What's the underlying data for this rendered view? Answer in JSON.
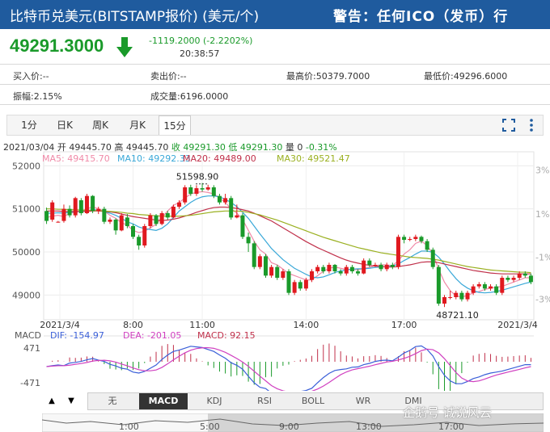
{
  "header": {
    "title": "比特币兑美元(BITSTAMP报价) (美元/个)",
    "warning": "警告：任何ICO（发币）行"
  },
  "quote": {
    "price": "49291.3000",
    "change": "-1119.2000 (-2.2202%)",
    "time": "20:38:57",
    "bid": "买入价:--",
    "ask": "卖出价:--",
    "high": "最高价:50379.7000",
    "low": "最低价:49296.6000",
    "amplitude": "振幅:2.15%",
    "volume": "成交量:6196.0000",
    "colors": {
      "down": "#1a9a2a",
      "up": "#e0191f"
    }
  },
  "tabs": [
    "1分",
    "日K",
    "周K",
    "月K",
    "15分"
  ],
  "active_tab": "15分",
  "ohlc": {
    "date": "2021/03/04",
    "open": "开 49445.70",
    "high": "高 49445.70",
    "close": "收 49291.30",
    "low": "低 49291.30",
    "vol": "量 0",
    "pct": "-0.31%"
  },
  "ma_legend": [
    {
      "label": "MA5: 49415.70",
      "color": "#f08aa8"
    },
    {
      "label": "MA10: 49292.33",
      "color": "#3aa8d8"
    },
    {
      "label": "MA20: 49489.00",
      "color": "#c0304a"
    },
    {
      "label": "MA30: 49521.47",
      "color": "#9ab020"
    }
  ],
  "macd_legend": [
    {
      "label": "MACD",
      "color": "#555555"
    },
    {
      "label": "DIF: -154.97",
      "color": "#3a5fd8"
    },
    {
      "label": "DEA: -201.05",
      "color": "#d040c0"
    },
    {
      "label": "MACD: 92.15",
      "color": "#c0304a"
    }
  ],
  "indicator_tabs": [
    "无",
    "MACD",
    "KDJ",
    "RSI",
    "BOLL",
    "WR",
    "DMI"
  ],
  "active_indicator": "MACD",
  "nav_buttons": [
    "▲",
    "▼"
  ],
  "navigator_labels": [
    "1:00",
    "5:00",
    "9:00",
    "13:00",
    "17:00"
  ],
  "watermark": "企鹅号 诚说风云",
  "chart_data": {
    "type": "candlestick",
    "y_ticks": [
      "52000",
      "51000",
      "50000",
      "49000"
    ],
    "ylim": [
      48650,
      52100
    ],
    "pct_ticks": [
      "3%",
      "1%",
      "-1%",
      "-3%"
    ],
    "x_ticks": [
      "2021/3/4",
      "8:00",
      "11:00",
      "14:00",
      "17:00",
      "2021/3/4"
    ],
    "annotations": {
      "max_label": "51598.90",
      "min_label": "48721.10"
    },
    "macd_ticks": [
      "471",
      "-471"
    ],
    "candles": [
      [
        50950,
        50720,
        51030,
        50650
      ],
      [
        50750,
        51150,
        51200,
        50700
      ],
      [
        50700,
        50700,
        50720,
        50680
      ],
      [
        50720,
        51000,
        51100,
        50680
      ],
      [
        51000,
        50850,
        51080,
        50800
      ],
      [
        50850,
        51250,
        51280,
        50800
      ],
      [
        51200,
        50900,
        51250,
        50850
      ],
      [
        50900,
        51300,
        51350,
        50880
      ],
      [
        51300,
        50950,
        51320,
        50900
      ],
      [
        50950,
        51000,
        51050,
        50880
      ],
      [
        51000,
        50700,
        51050,
        50650
      ],
      [
        50700,
        50750,
        50800,
        50650
      ],
      [
        50750,
        50500,
        50780,
        50400
      ],
      [
        50500,
        50850,
        50900,
        50480
      ],
      [
        50800,
        50600,
        50880,
        50550
      ],
      [
        50600,
        50350,
        50650,
        50300
      ],
      [
        50350,
        50150,
        50400,
        50050
      ],
      [
        50150,
        50600,
        50650,
        50100
      ],
      [
        50600,
        50850,
        50900,
        50550
      ],
      [
        50850,
        50650,
        50880,
        50600
      ],
      [
        50650,
        50900,
        50950,
        50620
      ],
      [
        50900,
        50800,
        50950,
        50750
      ],
      [
        50800,
        51050,
        51100,
        50780
      ],
      [
        51050,
        51150,
        51200,
        51000
      ],
      [
        51150,
        51500,
        51550,
        51100
      ],
      [
        51500,
        51350,
        51560,
        51300
      ],
      [
        51350,
        51480,
        51550,
        51300
      ],
      [
        51480,
        51450,
        51600,
        51400
      ],
      [
        51450,
        51500,
        51560,
        51420
      ],
      [
        51500,
        51300,
        51550,
        51250
      ],
      [
        51300,
        51150,
        51350,
        51100
      ],
      [
        51150,
        51250,
        51350,
        51100
      ],
      [
        51250,
        50800,
        51300,
        50750
      ],
      [
        50800,
        50850,
        51100,
        50780
      ],
      [
        50850,
        50350,
        50900,
        50300
      ],
      [
        50350,
        50200,
        50450,
        50000
      ],
      [
        50200,
        49650,
        50250,
        49600
      ],
      [
        49650,
        49900,
        49950,
        49600
      ],
      [
        49900,
        49450,
        49950,
        49400
      ],
      [
        49450,
        49650,
        49700,
        49400
      ],
      [
        49650,
        49400,
        49700,
        49350
      ],
      [
        49400,
        49550,
        49600,
        49350
      ],
      [
        49550,
        49050,
        49600,
        49000
      ],
      [
        49050,
        49300,
        49350,
        49000
      ],
      [
        49300,
        49150,
        49350,
        49100
      ],
      [
        49150,
        49350,
        49400,
        49100
      ],
      [
        49350,
        49550,
        49600,
        49300
      ],
      [
        49550,
        49650,
        49700,
        49500
      ],
      [
        49650,
        49550,
        49700,
        49500
      ],
      [
        49550,
        49700,
        49750,
        49500
      ],
      [
        49700,
        49550,
        49720,
        49500
      ],
      [
        49550,
        49500,
        49600,
        49450
      ],
      [
        49500,
        49650,
        49700,
        49450
      ],
      [
        49650,
        49550,
        49700,
        49500
      ],
      [
        49550,
        49500,
        49600,
        49450
      ],
      [
        49500,
        49800,
        49850,
        49480
      ],
      [
        49800,
        49700,
        49850,
        49650
      ],
      [
        49700,
        49700,
        49750,
        49650
      ],
      [
        49700,
        49600,
        49750,
        49550
      ],
      [
        49600,
        49700,
        49750,
        49550
      ],
      [
        49700,
        49650,
        49750,
        49600
      ],
      [
        49650,
        50350,
        50400,
        49600
      ],
      [
        50350,
        50280,
        50400,
        50200
      ],
      [
        50280,
        50300,
        50350,
        50250
      ],
      [
        50300,
        50350,
        50400,
        50250
      ],
      [
        50350,
        50250,
        50380,
        50200
      ],
      [
        50250,
        50050,
        50300,
        50000
      ],
      [
        50050,
        49650,
        50100,
        49600
      ],
      [
        49650,
        48800,
        49700,
        48750
      ],
      [
        48800,
        48950,
        49000,
        48721
      ],
      [
        48950,
        48950,
        49100,
        48900
      ],
      [
        48950,
        49050,
        49100,
        48900
      ],
      [
        49050,
        48900,
        49100,
        48850
      ],
      [
        48900,
        49050,
        49100,
        48850
      ],
      [
        49050,
        49200,
        49250,
        49000
      ],
      [
        49200,
        49250,
        49300,
        49150
      ],
      [
        49250,
        49150,
        49300,
        49100
      ],
      [
        49150,
        49200,
        49250,
        49100
      ],
      [
        49200,
        49050,
        49250,
        49000
      ],
      [
        49050,
        49400,
        49450,
        49000
      ],
      [
        49400,
        49350,
        49450,
        49300
      ],
      [
        49350,
        49400,
        49450,
        49300
      ],
      [
        49400,
        49500,
        49550,
        49350
      ],
      [
        49500,
        49450,
        49550,
        49400
      ],
      [
        49450,
        49300,
        49500,
        49250
      ]
    ],
    "ma5": [
      50800,
      50830,
      50850,
      50820,
      50900,
      50920,
      50950,
      51000,
      51050,
      51000,
      50950,
      50850,
      50780,
      50680,
      50620,
      50500,
      50450,
      50480,
      50560,
      50640,
      50800,
      50950,
      51080,
      51150,
      51250,
      51350,
      51380,
      51400,
      51380,
      51350,
      51250,
      51150,
      51000,
      50900,
      50750,
      50500,
      50250,
      50050,
      49950,
      49750,
      49700,
      49600,
      49500,
      49450,
      49400,
      49350,
      49350,
      49450,
      49550,
      49620,
      49650,
      49620,
      49590,
      49600,
      49580,
      49620,
      49640,
      49680,
      49700,
      49700,
      49680,
      49800,
      49950,
      50050,
      50200,
      50250,
      50150,
      49950,
      49600,
      49300,
      49100,
      48980,
      48950,
      48990,
      49050,
      49080,
      49130,
      49160,
      49180,
      49200,
      49250,
      49300,
      49350,
      49400,
      49400
    ],
    "ma10": [
      50900,
      50900,
      50910,
      50900,
      50920,
      50930,
      50940,
      50960,
      50980,
      50970,
      50940,
      50900,
      50850,
      50780,
      50700,
      50650,
      50580,
      50540,
      50520,
      50500,
      50550,
      50650,
      50800,
      50950,
      51050,
      51150,
      51230,
      51280,
      51300,
      51300,
      51280,
      51220,
      51150,
      51050,
      50920,
      50780,
      50600,
      50420,
      50250,
      50080,
      49950,
      49820,
      49720,
      49620,
      49550,
      49480,
      49420,
      49400,
      49420,
      49470,
      49520,
      49560,
      49580,
      49600,
      49610,
      49610,
      49620,
      49640,
      49650,
      49660,
      49670,
      49720,
      49800,
      49870,
      49950,
      50020,
      50020,
      49990,
      49880,
      49720,
      49540,
      49380,
      49250,
      49160,
      49100,
      49060,
      49050,
      49060,
      49080,
      49110,
      49150,
      49190,
      49230,
      49270,
      49300
    ],
    "ma20": [
      50950,
      50950,
      50950,
      50940,
      50940,
      50940,
      50940,
      50940,
      50950,
      50950,
      50940,
      50930,
      50910,
      50880,
      50850,
      50820,
      50800,
      50780,
      50760,
      50740,
      50730,
      50740,
      50760,
      50790,
      50830,
      50870,
      50920,
      50960,
      51000,
      51030,
      51040,
      51040,
      51030,
      51010,
      50980,
      50950,
      50900,
      50840,
      50780,
      50720,
      50640,
      50560,
      50480,
      50400,
      50320,
      50240,
      50170,
      50100,
      50040,
      49980,
      49920,
      49860,
      49810,
      49770,
      49740,
      49710,
      49690,
      49670,
      49660,
      49650,
      49650,
      49660,
      49680,
      49700,
      49730,
      49760,
      49770,
      49770,
      49750,
      49720,
      49690,
      49660,
      49630,
      49600,
      49570,
      49550,
      49530,
      49510,
      49500,
      49490,
      49490,
      49490,
      49490,
      49490,
      49490
    ],
    "ma30": [
      51000,
      51000,
      50990,
      50990,
      50980,
      50980,
      50970,
      50970,
      50960,
      50960,
      50950,
      50940,
      50930,
      50920,
      50900,
      50890,
      50870,
      50860,
      50850,
      50840,
      50830,
      50830,
      50830,
      50830,
      50840,
      50850,
      50870,
      50890,
      50910,
      50930,
      50940,
      50950,
      50950,
      50950,
      50940,
      50920,
      50890,
      50860,
      50820,
      50780,
      50740,
      50690,
      50640,
      50590,
      50540,
      50490,
      50440,
      50390,
      50340,
      50300,
      50260,
      50220,
      50180,
      50140,
      50100,
      50070,
      50040,
      50010,
      49980,
      49960,
      49940,
      49920,
      49900,
      49880,
      49870,
      49860,
      49850,
      49830,
      49810,
      49780,
      49750,
      49720,
      49690,
      49660,
      49640,
      49620,
      49600,
      49580,
      49570,
      49560,
      49550,
      49540,
      49530,
      49530,
      49520
    ]
  }
}
